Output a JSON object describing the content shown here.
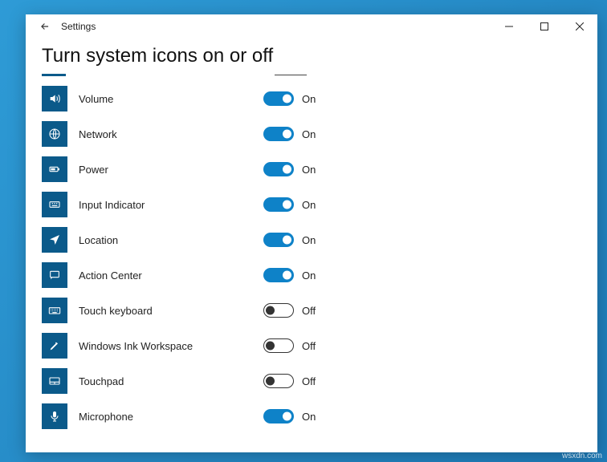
{
  "window": {
    "title": "Settings"
  },
  "page": {
    "heading": "Turn system icons on or off"
  },
  "state_labels": {
    "on": "On",
    "off": "Off"
  },
  "items": [
    {
      "id": "volume",
      "label": "Volume",
      "on": true,
      "icon": "volume"
    },
    {
      "id": "network",
      "label": "Network",
      "on": true,
      "icon": "globe"
    },
    {
      "id": "power",
      "label": "Power",
      "on": true,
      "icon": "battery"
    },
    {
      "id": "input",
      "label": "Input Indicator",
      "on": true,
      "icon": "input"
    },
    {
      "id": "location",
      "label": "Location",
      "on": true,
      "icon": "locate"
    },
    {
      "id": "action-center",
      "label": "Action Center",
      "on": true,
      "icon": "notify"
    },
    {
      "id": "touch-kbd",
      "label": "Touch keyboard",
      "on": false,
      "icon": "keyboard"
    },
    {
      "id": "ink",
      "label": "Windows Ink Workspace",
      "on": false,
      "icon": "pen"
    },
    {
      "id": "touchpad",
      "label": "Touchpad",
      "on": false,
      "icon": "touchpad"
    },
    {
      "id": "microphone",
      "label": "Microphone",
      "on": true,
      "icon": "mic"
    }
  ],
  "watermark": "wsxdn.com"
}
